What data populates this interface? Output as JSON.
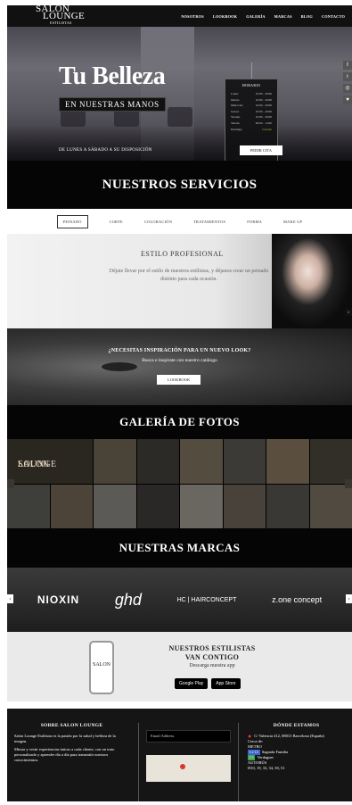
{
  "nav": {
    "logo": {
      "line1": "SALON",
      "line2": "LOUNGE",
      "line3": "ESTILISTAS"
    },
    "links": [
      "NOSOTROS",
      "LOOKBOOK",
      "GALERÍA",
      "MARCAS",
      "BLOG",
      "CONTACTO"
    ]
  },
  "hero": {
    "title": "Tu Belleza",
    "subtitle": "EN NUESTRAS MANOS",
    "hours_title": "HORARIO",
    "hours": [
      {
        "day": "Lunes",
        "time": "10:00 - 20:00"
      },
      {
        "day": "Martes",
        "time": "10:00 - 20:00"
      },
      {
        "day": "Miércoles",
        "time": "10:00 - 20:00"
      },
      {
        "day": "Jueves",
        "time": "10:00 - 20:00"
      },
      {
        "day": "Viernes",
        "time": "10:00 - 20:00"
      },
      {
        "day": "Sábado",
        "time": "09:00 - 14:00"
      },
      {
        "day": "Domingo",
        "time": "Cerrado"
      }
    ],
    "bar_text": "DE LUNES A SÁBADO A SU DISPOSICIÓN",
    "bar_button": "PEDIR CITA"
  },
  "services": {
    "title": "NUESTROS SERVICIOS",
    "tabs": [
      "PEINADO",
      "CORTE",
      "COLORACIÓN",
      "TRATAMIENTOS",
      "FORMA",
      "MAKE UP"
    ],
    "active_tab": "PEINADO",
    "heading": "ESTILO PROFESIONAL",
    "text": "Déjate llevar por el estilo de nuestros estilistas, y déjanos crear un peinado distinto para cada ocasión."
  },
  "inspiration": {
    "heading": "¿NECESITAS INSPIRACIÓN PARA UN NUEVO LOOK?",
    "text": "Busca e inspírate con nuestro catálogo",
    "button": "LOOKBOOK"
  },
  "gallery": {
    "title": "GALERÍA DE FOTOS",
    "logo_line1": "SALON",
    "logo_line2": "LOUNGE"
  },
  "brands": {
    "title": "NUESTRAS MARCAS",
    "items": [
      "NIOXIN",
      "ghd",
      "HC | HAIRCONCEPT",
      "z.one concept"
    ]
  },
  "app": {
    "phone_label": "SALON",
    "heading_line1": "NUESTROS ESTILISTAS",
    "heading_line2": "VAN CONTIGO",
    "text": "Descarga nuestra app",
    "google_play": "Google Play",
    "app_store": "App Store"
  },
  "footer": {
    "about_title": "SOBRE SALON LOUNGE",
    "about_text1": "Salon Lounge Estilistas es la pasión por la salud y belleza de la imagen.",
    "about_text2": "Mimar y vestir experiencias únicas a cada cliente, con un trato personalizado y aprender día a día para transmitir nuestros conocimientos.",
    "email_placeholder": "Email Address",
    "location_title": "DÓNDE ESTAMOS",
    "address": "C/ Valencia 412, 08013 Barcelona (España)",
    "near": "Cerca de:",
    "metro_label": "METRO",
    "metro_line": "L2  L5",
    "metro_station": "Sagrada Familia",
    "metro_line2": "L5",
    "metro_station2": "Verdaguer",
    "bus_label": "AUTOBÚS",
    "bus_lines": "H10, 19, 33, 34, 50, 51"
  }
}
